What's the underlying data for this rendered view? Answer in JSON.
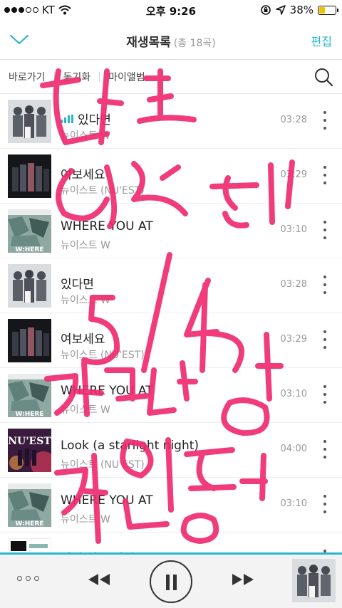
{
  "status_bar": {
    "carrier": "KT",
    "time": "오후 9:26",
    "battery": "38%",
    "battery_level": 0.38
  },
  "nav": {
    "title": "재생목록",
    "count": "(총 18곡)",
    "edit": "편집",
    "back_icon": "chevron-down-icon"
  },
  "tabs": [
    {
      "label": "바로가기"
    },
    {
      "label": "동기화"
    },
    {
      "label": "마이앨범"
    }
  ],
  "search_icon": "search-icon",
  "tracks": [
    {
      "title": "있다면",
      "artist": "뉴이스트 W",
      "duration": "03:28",
      "cover": "group",
      "playing": true
    },
    {
      "title": "여보세요",
      "artist": "뉴이스트 (NU'EST)",
      "duration": "03:29",
      "cover": "dark"
    },
    {
      "title": "WHERE YOU AT",
      "artist": "뉴이스트 W",
      "duration": "03:10",
      "cover": "where"
    },
    {
      "title": "있다면",
      "artist": "뉴이스트 W",
      "duration": "03:28",
      "cover": "group"
    },
    {
      "title": "여보세요",
      "artist": "뉴이스트 (NU'EST)",
      "duration": "03:29",
      "cover": "dark"
    },
    {
      "title": "WHERE YOU AT",
      "artist": "뉴이스트 W",
      "duration": "03:10",
      "cover": "where"
    },
    {
      "title": "Look (a starlight night)",
      "artist": "뉴이스트 (NU'EST)",
      "duration": "04:00",
      "cover": "nuest"
    },
    {
      "title": "WHERE YOU AT",
      "artist": "뉴이스트 W",
      "duration": "03:10",
      "cover": "where"
    },
    {
      "title": "사랑 없는 사랑",
      "artist": "",
      "duration": "",
      "cover": "white"
    }
  ],
  "cover_texts": {
    "where": "W:HERE",
    "nuest": "NU'EST"
  },
  "player": {
    "menu_icon": "more-horizontal-icon",
    "prev_icon": "rewind-icon",
    "pause_icon": "pause-icon",
    "next_icon": "fast-forward-icon"
  },
  "colors": {
    "accent": "#2ab5c9",
    "ink": "#f0286e",
    "battery": "#f0c400"
  }
}
